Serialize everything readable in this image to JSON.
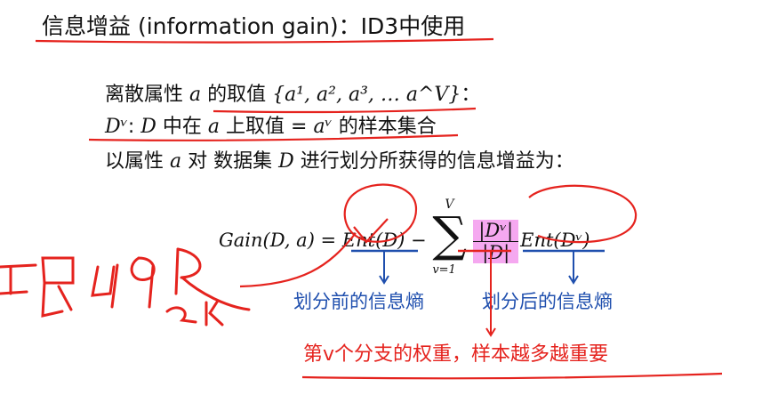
{
  "slide": {
    "title": "信息增益 (information gain)：ID3中使用",
    "line1": {
      "prefix": "离散属性 ",
      "var": "a",
      "mid": " 的取值 ",
      "set": "{a¹, a², a³, … a^V}",
      "suffix": "："
    },
    "line2": {
      "d_v": "Dᵛ",
      "colon": ": ",
      "d": "D",
      "t1": " 中在 ",
      "a": "a",
      "t2": " 上取值 = ",
      "av": "aᵛ",
      "t3": " 的样本集合"
    },
    "line3": {
      "t1": "以属性 ",
      "a": "a",
      "t2": " 对 数据集 ",
      "d": "D",
      "t3": " 进行划分所获得的信息增益为："
    },
    "formula": {
      "lhs": "Gain(D, a) = ",
      "ent_d": "Ent(D)",
      "minus": " − ",
      "sum_upper": "V",
      "sum_symbol": "∑",
      "sum_lower": "v=1",
      "frac_num": "|Dᵛ|",
      "frac_den": "|D|",
      "ent_dv": "Ent(Dᵛ)"
    },
    "annotations": {
      "before_entropy": "划分前的信息熵",
      "after_entropy": "划分后的信息熵",
      "weight": "第v个分支的权重，样本越多越重要"
    },
    "colors": {
      "blue": "#1f4fae",
      "red": "#e5231e",
      "highlight": "#f5a8f0"
    }
  }
}
